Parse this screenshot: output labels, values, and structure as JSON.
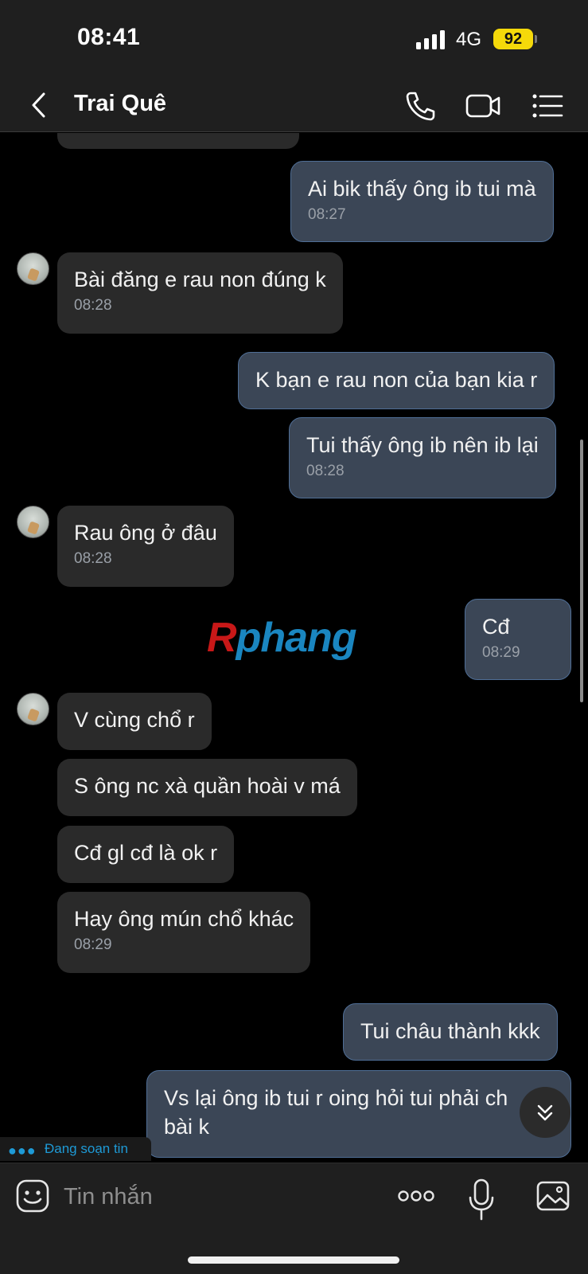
{
  "status_bar": {
    "time": "08:41",
    "network": "4G",
    "battery": "92"
  },
  "header": {
    "back_icon": "chevron-left-icon",
    "contact_name": "Trai Quê",
    "call_icon": "phone-icon",
    "video_icon": "video-camera-icon",
    "menu_icon": "list-icon"
  },
  "messages": [
    {
      "direction": "out",
      "text": "Ai bik thấy ông ib tui mà",
      "time": "08:27"
    },
    {
      "direction": "in",
      "text": "Bài đăng e rau non đúng k",
      "time": "08:28"
    },
    {
      "direction": "out",
      "text": "K bạn e rau non của bạn kia r",
      "time": ""
    },
    {
      "direction": "out",
      "text": "Tui thấy ông ib nên ib lại",
      "time": "08:28"
    },
    {
      "direction": "in",
      "text": "Rau ông ở đâu",
      "time": "08:28"
    },
    {
      "direction": "out",
      "text": "Cđ",
      "time": "08:29"
    },
    {
      "direction": "in",
      "text": "V cùng chổ r",
      "time": ""
    },
    {
      "direction": "in",
      "text": "S ông nc xà quần hoài v má",
      "time": ""
    },
    {
      "direction": "in",
      "text": "Cđ gl cđ là ok r",
      "time": ""
    },
    {
      "direction": "in",
      "text": "Hay ông mún chổ khác",
      "time": "08:29"
    },
    {
      "direction": "out",
      "text": "Tui châu thành kkk",
      "time": ""
    },
    {
      "direction": "out",
      "text": "Vs lại ông ib tui r oing hỏi tui phải ch",
      "text2": "bài k",
      "time": ""
    }
  ],
  "watermark": {
    "first": "R",
    "rest": "phang"
  },
  "typing_indicator": "Đang soạn tin",
  "input_bar": {
    "sticker_icon": "emoji-icon",
    "placeholder": "Tin nhắn",
    "more_icon": "more-dots-icon",
    "mic_icon": "microphone-icon",
    "image_icon": "image-icon"
  },
  "scroll_down_icon": "chevron-double-down-icon",
  "colors": {
    "background": "#000000",
    "bar": "#1f1f1f",
    "incoming_bubble": "#2a2a2a",
    "outgoing_bubble": "#3b4656",
    "accent": "#1e9ad6",
    "battery": "#f5d90a"
  }
}
